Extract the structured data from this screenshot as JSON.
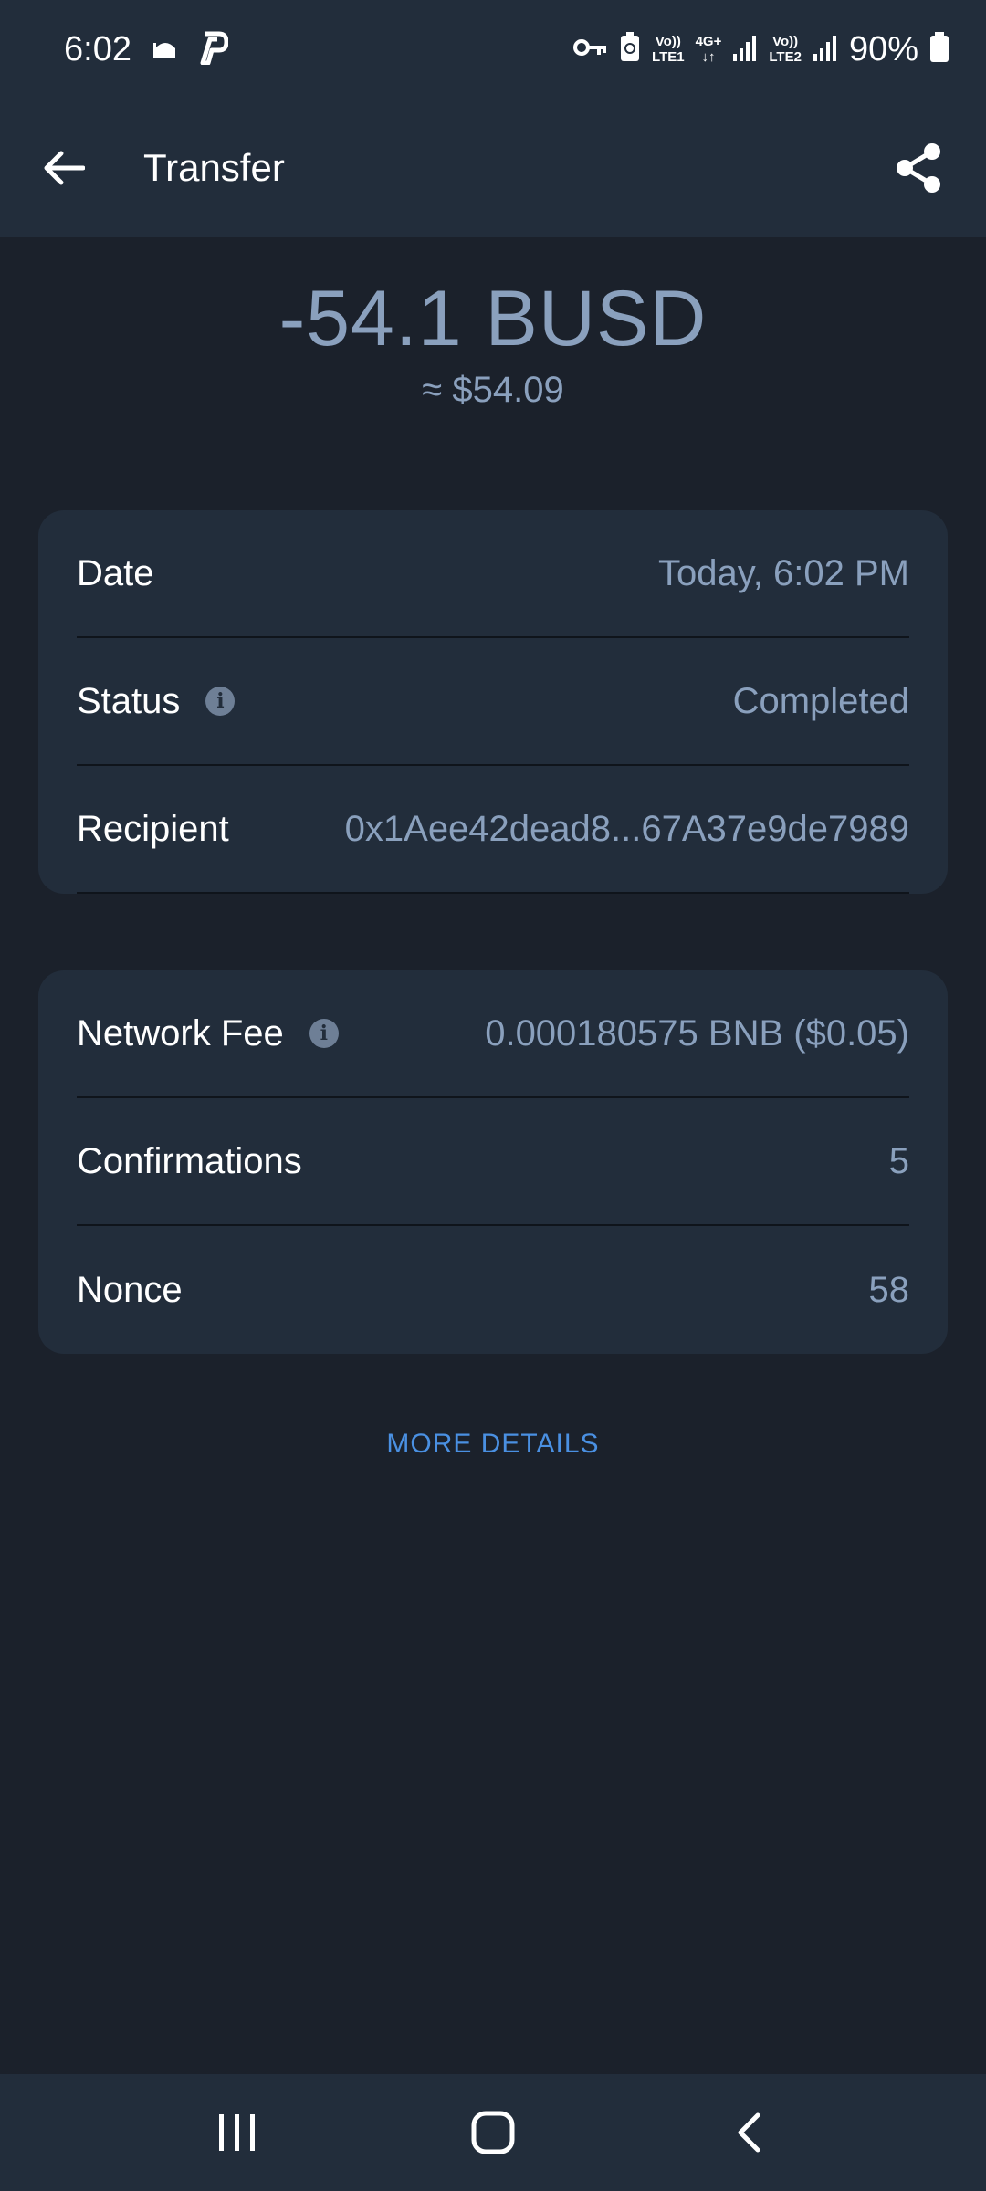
{
  "status_bar": {
    "time": "6:02",
    "volte1_top": "Vo))",
    "volte1_bottom": "LTE1",
    "net_top": "4G+",
    "volte2_top": "Vo))",
    "volte2_bottom": "LTE2",
    "battery": "90%"
  },
  "app_bar": {
    "title": "Transfer"
  },
  "transaction": {
    "amount": "-54.1 BUSD",
    "amount_usd": "≈ $54.09"
  },
  "details": {
    "date_label": "Date",
    "date_value": "Today, 6:02 PM",
    "status_label": "Status",
    "status_value": "Completed",
    "recipient_label": "Recipient",
    "recipient_value": "0x1Aee42dead8...67A37e9de7989"
  },
  "network": {
    "fee_label": "Network Fee",
    "fee_value": "0.000180575 BNB ($0.05)",
    "confirmations_label": "Confirmations",
    "confirmations_value": "5",
    "nonce_label": "Nonce",
    "nonce_value": "58"
  },
  "more_details": "MORE DETAILS",
  "icons": {
    "info": "i"
  },
  "colors": {
    "background": "#1b212b",
    "surface": "#222d3b",
    "muted_text": "#8aa0bd",
    "link": "#4a90e2"
  }
}
